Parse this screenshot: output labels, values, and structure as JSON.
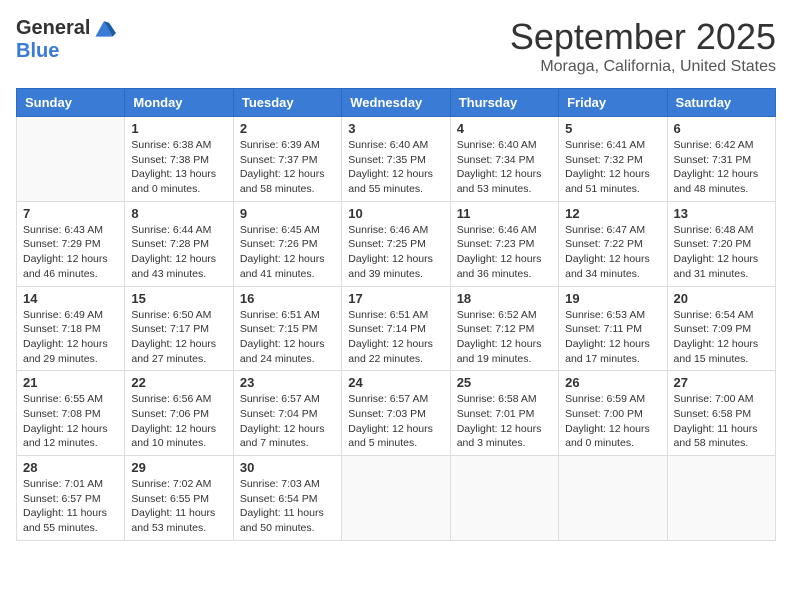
{
  "header": {
    "logo_general": "General",
    "logo_blue": "Blue",
    "month_title": "September 2025",
    "location": "Moraga, California, United States"
  },
  "weekdays": [
    "Sunday",
    "Monday",
    "Tuesday",
    "Wednesday",
    "Thursday",
    "Friday",
    "Saturday"
  ],
  "weeks": [
    [
      {
        "day": "",
        "sunrise": "",
        "sunset": "",
        "daylight": ""
      },
      {
        "day": "1",
        "sunrise": "Sunrise: 6:38 AM",
        "sunset": "Sunset: 7:38 PM",
        "daylight": "Daylight: 13 hours and 0 minutes."
      },
      {
        "day": "2",
        "sunrise": "Sunrise: 6:39 AM",
        "sunset": "Sunset: 7:37 PM",
        "daylight": "Daylight: 12 hours and 58 minutes."
      },
      {
        "day": "3",
        "sunrise": "Sunrise: 6:40 AM",
        "sunset": "Sunset: 7:35 PM",
        "daylight": "Daylight: 12 hours and 55 minutes."
      },
      {
        "day": "4",
        "sunrise": "Sunrise: 6:40 AM",
        "sunset": "Sunset: 7:34 PM",
        "daylight": "Daylight: 12 hours and 53 minutes."
      },
      {
        "day": "5",
        "sunrise": "Sunrise: 6:41 AM",
        "sunset": "Sunset: 7:32 PM",
        "daylight": "Daylight: 12 hours and 51 minutes."
      },
      {
        "day": "6",
        "sunrise": "Sunrise: 6:42 AM",
        "sunset": "Sunset: 7:31 PM",
        "daylight": "Daylight: 12 hours and 48 minutes."
      }
    ],
    [
      {
        "day": "7",
        "sunrise": "Sunrise: 6:43 AM",
        "sunset": "Sunset: 7:29 PM",
        "daylight": "Daylight: 12 hours and 46 minutes."
      },
      {
        "day": "8",
        "sunrise": "Sunrise: 6:44 AM",
        "sunset": "Sunset: 7:28 PM",
        "daylight": "Daylight: 12 hours and 43 minutes."
      },
      {
        "day": "9",
        "sunrise": "Sunrise: 6:45 AM",
        "sunset": "Sunset: 7:26 PM",
        "daylight": "Daylight: 12 hours and 41 minutes."
      },
      {
        "day": "10",
        "sunrise": "Sunrise: 6:46 AM",
        "sunset": "Sunset: 7:25 PM",
        "daylight": "Daylight: 12 hours and 39 minutes."
      },
      {
        "day": "11",
        "sunrise": "Sunrise: 6:46 AM",
        "sunset": "Sunset: 7:23 PM",
        "daylight": "Daylight: 12 hours and 36 minutes."
      },
      {
        "day": "12",
        "sunrise": "Sunrise: 6:47 AM",
        "sunset": "Sunset: 7:22 PM",
        "daylight": "Daylight: 12 hours and 34 minutes."
      },
      {
        "day": "13",
        "sunrise": "Sunrise: 6:48 AM",
        "sunset": "Sunset: 7:20 PM",
        "daylight": "Daylight: 12 hours and 31 minutes."
      }
    ],
    [
      {
        "day": "14",
        "sunrise": "Sunrise: 6:49 AM",
        "sunset": "Sunset: 7:18 PM",
        "daylight": "Daylight: 12 hours and 29 minutes."
      },
      {
        "day": "15",
        "sunrise": "Sunrise: 6:50 AM",
        "sunset": "Sunset: 7:17 PM",
        "daylight": "Daylight: 12 hours and 27 minutes."
      },
      {
        "day": "16",
        "sunrise": "Sunrise: 6:51 AM",
        "sunset": "Sunset: 7:15 PM",
        "daylight": "Daylight: 12 hours and 24 minutes."
      },
      {
        "day": "17",
        "sunrise": "Sunrise: 6:51 AM",
        "sunset": "Sunset: 7:14 PM",
        "daylight": "Daylight: 12 hours and 22 minutes."
      },
      {
        "day": "18",
        "sunrise": "Sunrise: 6:52 AM",
        "sunset": "Sunset: 7:12 PM",
        "daylight": "Daylight: 12 hours and 19 minutes."
      },
      {
        "day": "19",
        "sunrise": "Sunrise: 6:53 AM",
        "sunset": "Sunset: 7:11 PM",
        "daylight": "Daylight: 12 hours and 17 minutes."
      },
      {
        "day": "20",
        "sunrise": "Sunrise: 6:54 AM",
        "sunset": "Sunset: 7:09 PM",
        "daylight": "Daylight: 12 hours and 15 minutes."
      }
    ],
    [
      {
        "day": "21",
        "sunrise": "Sunrise: 6:55 AM",
        "sunset": "Sunset: 7:08 PM",
        "daylight": "Daylight: 12 hours and 12 minutes."
      },
      {
        "day": "22",
        "sunrise": "Sunrise: 6:56 AM",
        "sunset": "Sunset: 7:06 PM",
        "daylight": "Daylight: 12 hours and 10 minutes."
      },
      {
        "day": "23",
        "sunrise": "Sunrise: 6:57 AM",
        "sunset": "Sunset: 7:04 PM",
        "daylight": "Daylight: 12 hours and 7 minutes."
      },
      {
        "day": "24",
        "sunrise": "Sunrise: 6:57 AM",
        "sunset": "Sunset: 7:03 PM",
        "daylight": "Daylight: 12 hours and 5 minutes."
      },
      {
        "day": "25",
        "sunrise": "Sunrise: 6:58 AM",
        "sunset": "Sunset: 7:01 PM",
        "daylight": "Daylight: 12 hours and 3 minutes."
      },
      {
        "day": "26",
        "sunrise": "Sunrise: 6:59 AM",
        "sunset": "Sunset: 7:00 PM",
        "daylight": "Daylight: 12 hours and 0 minutes."
      },
      {
        "day": "27",
        "sunrise": "Sunrise: 7:00 AM",
        "sunset": "Sunset: 6:58 PM",
        "daylight": "Daylight: 11 hours and 58 minutes."
      }
    ],
    [
      {
        "day": "28",
        "sunrise": "Sunrise: 7:01 AM",
        "sunset": "Sunset: 6:57 PM",
        "daylight": "Daylight: 11 hours and 55 minutes."
      },
      {
        "day": "29",
        "sunrise": "Sunrise: 7:02 AM",
        "sunset": "Sunset: 6:55 PM",
        "daylight": "Daylight: 11 hours and 53 minutes."
      },
      {
        "day": "30",
        "sunrise": "Sunrise: 7:03 AM",
        "sunset": "Sunset: 6:54 PM",
        "daylight": "Daylight: 11 hours and 50 minutes."
      },
      {
        "day": "",
        "sunrise": "",
        "sunset": "",
        "daylight": ""
      },
      {
        "day": "",
        "sunrise": "",
        "sunset": "",
        "daylight": ""
      },
      {
        "day": "",
        "sunrise": "",
        "sunset": "",
        "daylight": ""
      },
      {
        "day": "",
        "sunrise": "",
        "sunset": "",
        "daylight": ""
      }
    ]
  ]
}
